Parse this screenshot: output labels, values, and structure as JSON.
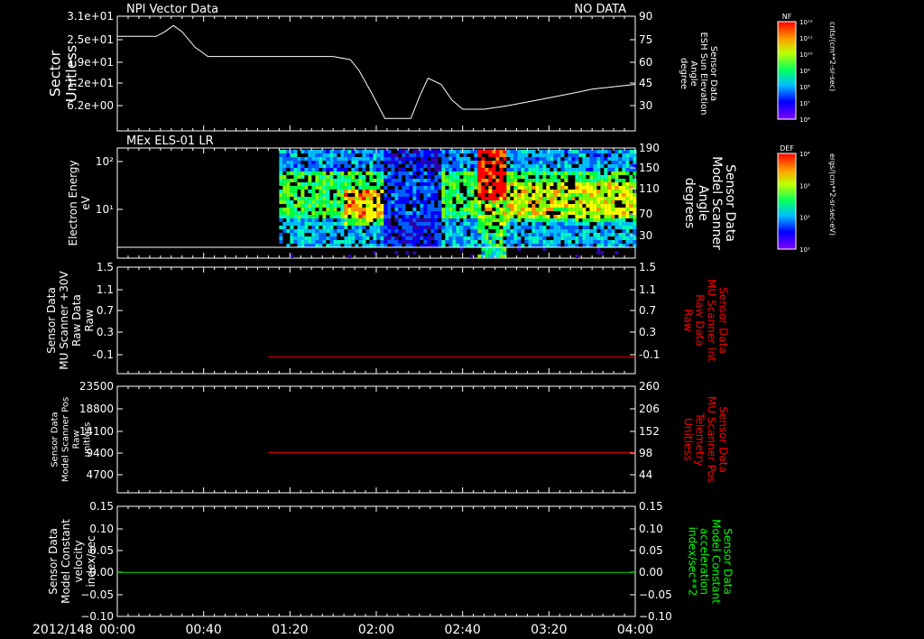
{
  "colors": {
    "background": "#000000",
    "axis": "#ffffff",
    "trace_white": "#ffffff",
    "trace_red": "#ff0000",
    "trace_green": "#00dd00",
    "label_red": "#ff0000",
    "label_green": "#00ff00"
  },
  "time_axis": {
    "date_label": "2012/148",
    "ticks": [
      "00:00",
      "00:40",
      "01:20",
      "02:00",
      "02:40",
      "03:20",
      "04:00"
    ]
  },
  "chart_data": [
    {
      "type": "line",
      "title": "NPI Vector Data",
      "status": "NO DATA",
      "ylabel": "Sector\nUnitless",
      "y2label": "Sensor Data\nESH Sun Elevation\nAngle\ndegree",
      "left_ticks": [
        "3.1e+01",
        "2.5e+01",
        "1.9e+01",
        "1.2e+01",
        "6.2e+00"
      ],
      "right_ticks": [
        "90",
        "75",
        "60",
        "45",
        "30"
      ],
      "ylim": [
        16,
        90
      ],
      "series": [
        {
          "color": "white",
          "x": [
            0,
            12,
            18,
            22,
            26,
            30,
            36,
            42,
            50,
            60,
            70,
            80,
            90,
            100,
            108,
            112,
            118,
            124,
            128,
            136,
            140,
            144,
            150,
            155,
            160,
            170,
            180,
            195,
            210,
            220,
            240
          ],
          "y": [
            77,
            77,
            77,
            80,
            84,
            80,
            70,
            64,
            64,
            64,
            64,
            64,
            64,
            64,
            62,
            55,
            40,
            24,
            24,
            24,
            38,
            50,
            46,
            36,
            30,
            30,
            32,
            36,
            40,
            43,
            46
          ]
        }
      ],
      "colorbar": {
        "title": "NF",
        "unit": "cnts/(cm**2-sr-sec)",
        "ticks": [
          "10¹²",
          "10¹¹",
          "10¹⁰",
          "10⁹",
          "10⁸",
          "10⁷",
          "10⁶"
        ]
      }
    },
    {
      "type": "heatmap",
      "title": "MEx ELS-01 LR",
      "ylabel": "Electron Energy\neV",
      "y2label": "Sensor Data\nModel Scanner\nAngle\ndegrees",
      "left_ticks": [
        "10²",
        "10¹"
      ],
      "right_ticks": [
        "190",
        "150",
        "110",
        "70",
        "30"
      ],
      "data_start_time": "01:15",
      "colorbar": {
        "title": "DEF",
        "unit": "ergs/(cm**2-sr-sec-eV)",
        "ticks": [
          "10⁴",
          "10³",
          "10²",
          "10¹"
        ]
      }
    },
    {
      "type": "line",
      "ylabel": "Sensor Data\nMU Scanner +30V\nRaw Data\nRaw",
      "y2label": "Sensor Data\nMU Scanner Int\nRaw Data\nRaw",
      "left_ticks": [
        "1.5",
        "1.1",
        "0.7",
        "0.3",
        "-0.1"
      ],
      "right_ticks": [
        "1.5",
        "1.1",
        "0.7",
        "0.3",
        "-0.1"
      ],
      "ylim": [
        -0.3,
        1.5
      ],
      "series": [
        {
          "color": "red",
          "x": [
            70,
            240
          ],
          "y": [
            -0.02,
            -0.02
          ]
        }
      ]
    },
    {
      "type": "line",
      "ylabel": "Sensor Data\nModel Scanner Pos\nRaw\nunitless",
      "y2label": "Sensor Data\nMU Scanner Pos\nTelemetry\nUnitless",
      "left_ticks": [
        "23500",
        "18800",
        "14100",
        "9400",
        "4700"
      ],
      "right_ticks": [
        "260",
        "206",
        "152",
        "98",
        "44"
      ],
      "ylim": [
        0,
        23500
      ],
      "series": [
        {
          "color": "red",
          "x": [
            70,
            240
          ],
          "y": [
            8900,
            8900
          ]
        }
      ]
    },
    {
      "type": "line",
      "ylabel": "Sensor Data\nModel Constant\nvelocity\nindex/sec",
      "y2label": "Sensor Data\nModel Constant\nacceleration\nindex/sec**2",
      "left_ticks": [
        "0.15",
        "0.10",
        "0.05",
        "0.00",
        "−0.05",
        "−0.10"
      ],
      "right_ticks": [
        "0.15",
        "0.10",
        "0.05",
        "0.00",
        "−0.05",
        "−0.10"
      ],
      "ylim": [
        -0.1,
        0.15
      ],
      "series": [
        {
          "color": "green",
          "x": [
            0,
            240
          ],
          "y": [
            0,
            0
          ]
        }
      ]
    }
  ]
}
